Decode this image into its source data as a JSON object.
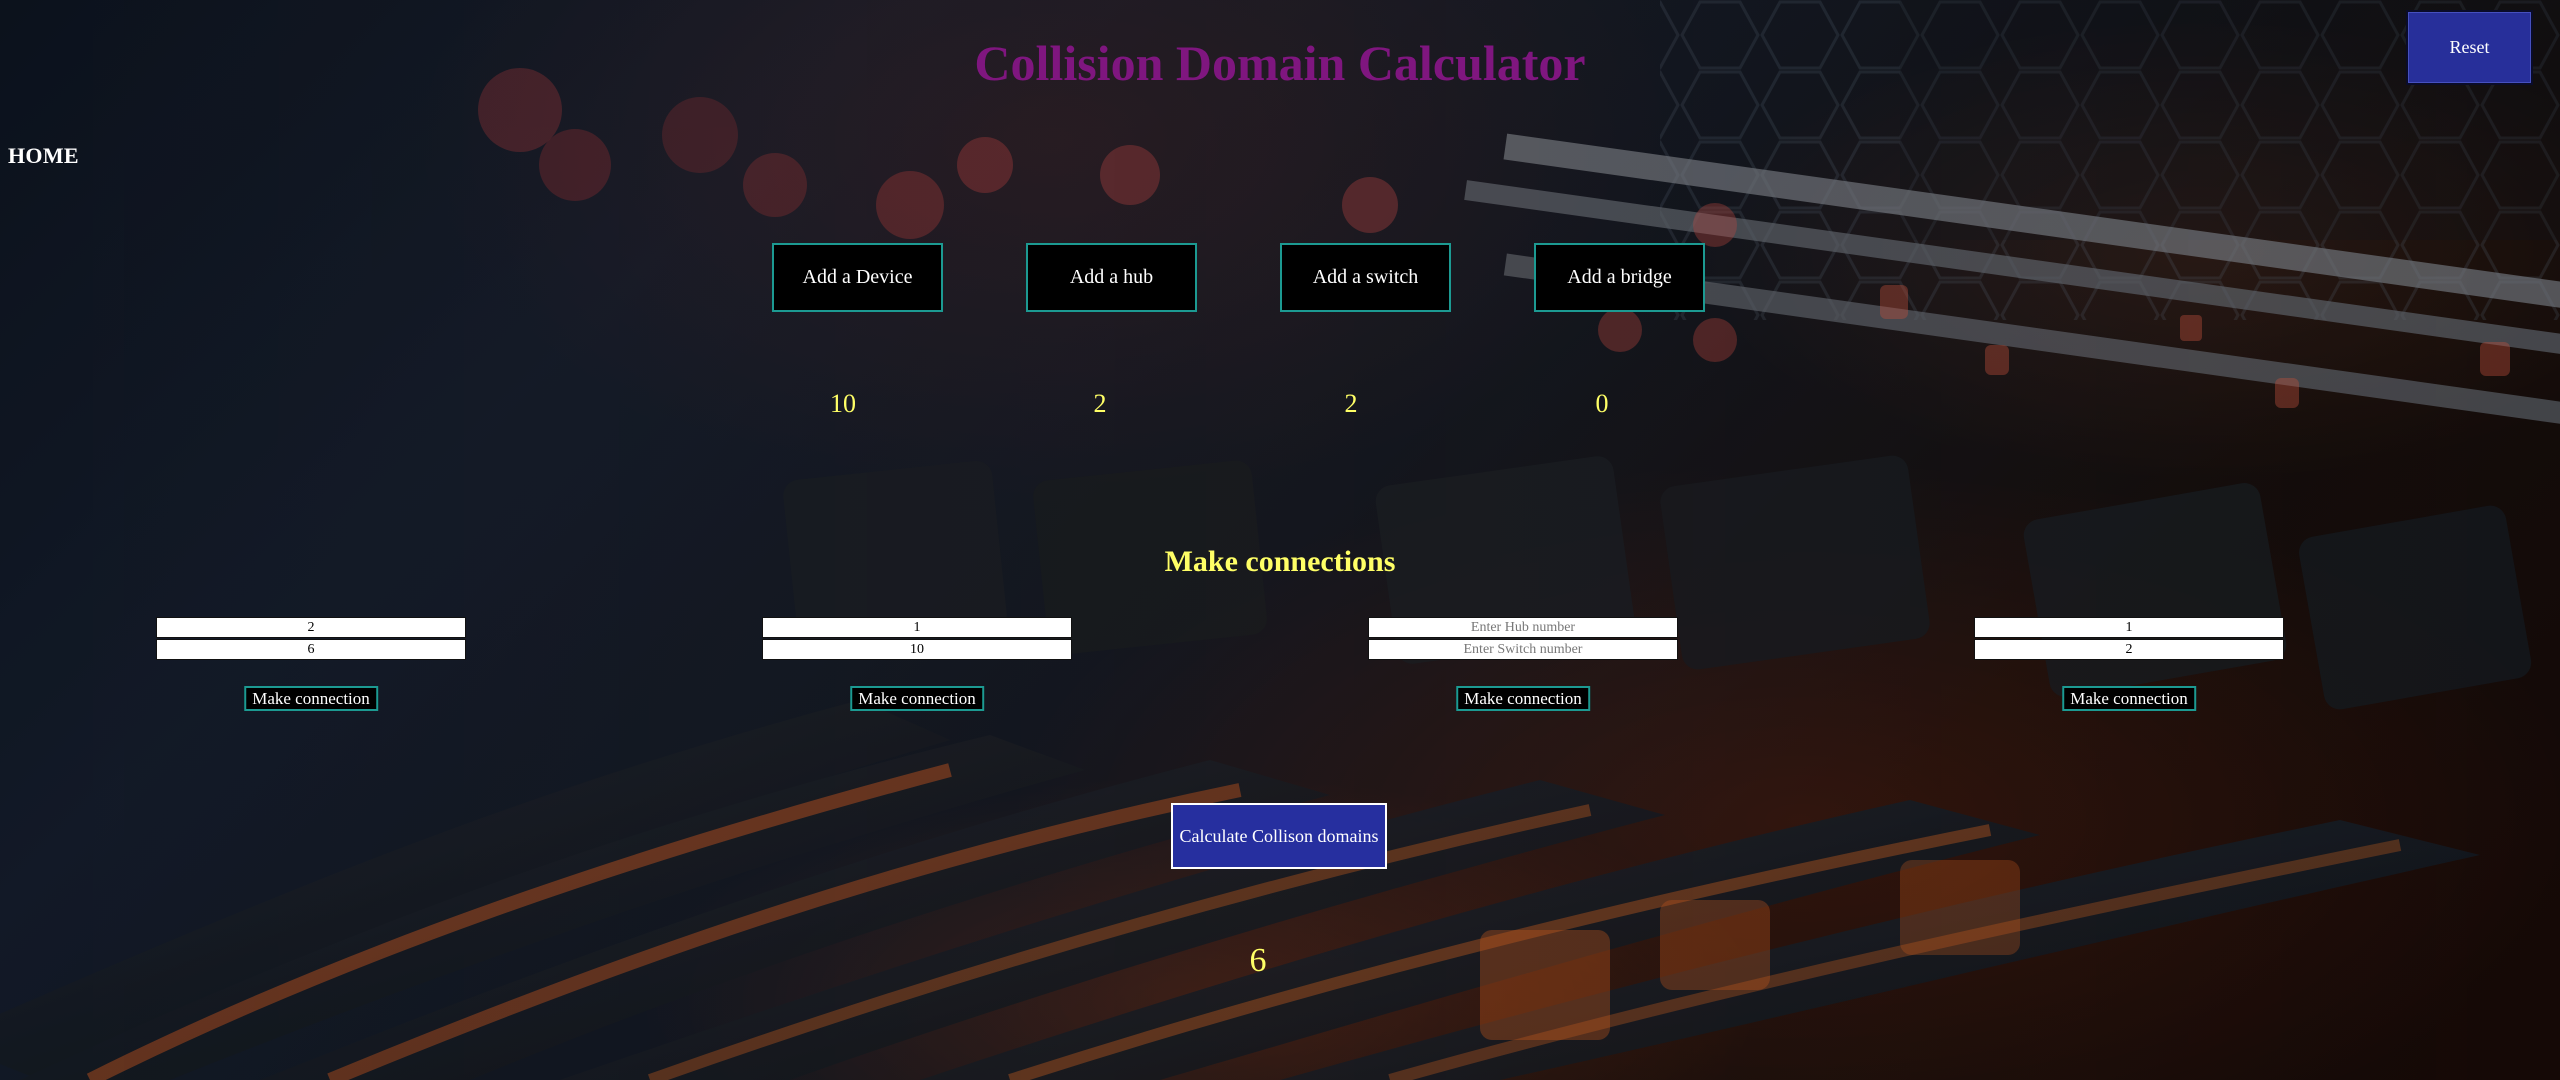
{
  "header": {
    "title": "Collision Domain Calculator",
    "reset_label": "Reset",
    "home_label": "HOME"
  },
  "components": {
    "device": {
      "button_label": "Add a Device",
      "count": "10"
    },
    "hub": {
      "button_label": "Add a hub",
      "count": "2"
    },
    "switch": {
      "button_label": "Add a switch",
      "count": "2"
    },
    "bridge": {
      "button_label": "Add a bridge",
      "count": "0"
    }
  },
  "connections": {
    "title": "Make connections",
    "groups": [
      {
        "field1_value": "2",
        "field1_placeholder": "",
        "field2_value": "6",
        "field2_placeholder": "",
        "button_label": "Make connection"
      },
      {
        "field1_value": "1",
        "field1_placeholder": "",
        "field2_value": "10",
        "field2_placeholder": "",
        "button_label": "Make connection"
      },
      {
        "field1_value": "",
        "field1_placeholder": "Enter Hub number",
        "field2_value": "",
        "field2_placeholder": "Enter Switch number",
        "button_label": "Make connection"
      },
      {
        "field1_value": "1",
        "field1_placeholder": "",
        "field2_value": "2",
        "field2_placeholder": "",
        "button_label": "Make connection"
      }
    ]
  },
  "calculate": {
    "button_label": "Calculate Collison domains",
    "result": "6"
  },
  "theme": {
    "title_color": "#7f167f",
    "accent_yellow": "#ffff66",
    "button_blue": "#262f9f",
    "border_teal": "#1c9a92"
  }
}
